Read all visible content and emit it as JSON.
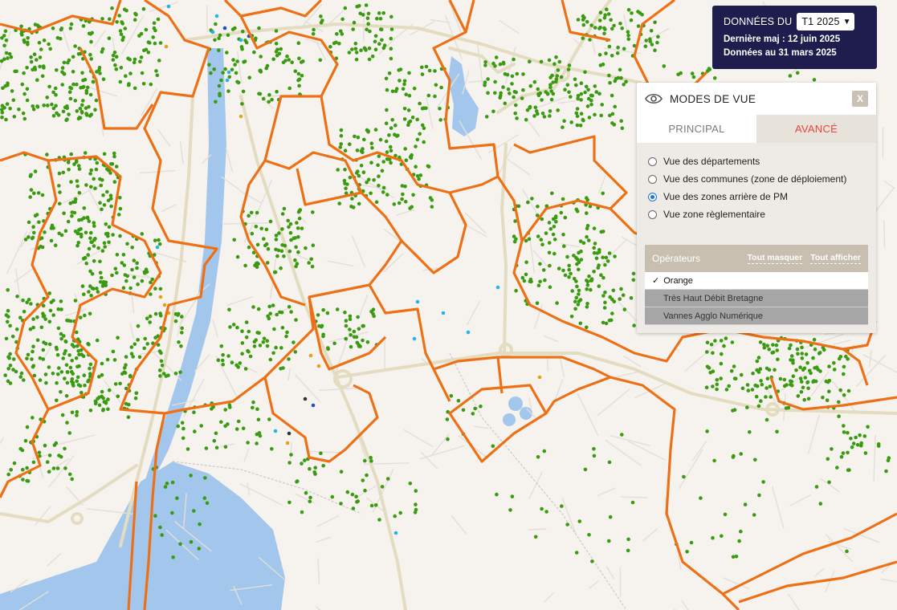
{
  "header": {
    "label": "DONNÉES DU",
    "period": "T1 2025",
    "last_update": "Dernière maj : 12 juin 2025",
    "data_as_of": "Données au 31 mars 2025"
  },
  "panel": {
    "title": "MODES DE VUE",
    "close_label": "X",
    "tabs": [
      {
        "label": "PRINCIPAL",
        "active": false
      },
      {
        "label": "AVANCÉ",
        "active": true
      }
    ],
    "options": [
      {
        "label": "Vue des départements",
        "checked": false
      },
      {
        "label": "Vue des communes (zone de déploiement)",
        "checked": false
      },
      {
        "label": "Vue des zones arrière de PM",
        "checked": true
      },
      {
        "label": "Vue zone règlementaire",
        "checked": false
      }
    ],
    "operators_title": "Opérateurs",
    "hide_all": "Tout masquer",
    "show_all": "Tout afficher",
    "operators": [
      {
        "label": "Orange",
        "enabled": true,
        "check": "✓"
      },
      {
        "label": "Très Haut Débit Bretagne",
        "enabled": false
      },
      {
        "label": "Vannes Agglo Numérique",
        "enabled": false
      }
    ]
  },
  "map": {
    "colors": {
      "background": "#f6f3ee",
      "water": "#a3c6ec",
      "road": "#e3dcc0",
      "street": "#e2dfd8",
      "zone_boundary": "#ee7016",
      "premise_dot": "#3a9a12",
      "dot_cyan": "#27b3e8",
      "dot_yellow": "#e0a31a",
      "dot_dark": "#333333",
      "dot_blue": "#1f4fb7"
    },
    "icons": [
      "eye-icon",
      "close-icon",
      "check-icon",
      "chevron-down-icon"
    ]
  }
}
